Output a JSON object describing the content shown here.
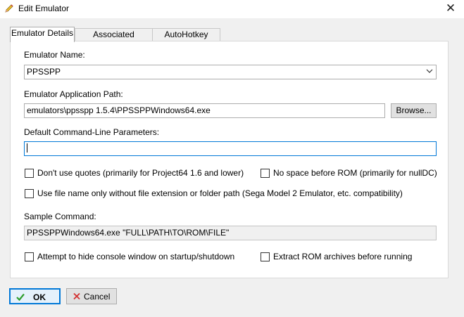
{
  "window": {
    "title": "Edit Emulator",
    "close_glyph": "✕"
  },
  "tabs": [
    {
      "label": "Emulator Details",
      "active": true
    },
    {
      "label": "Associated Platforms",
      "active": false
    },
    {
      "label": "AutoHotkey Script",
      "active": false
    }
  ],
  "form": {
    "name_label": "Emulator Name:",
    "name_value": "PPSSPP",
    "path_label": "Emulator Application Path:",
    "path_value": "emulators\\ppsspp 1.5.4\\PPSSPPWindows64.exe",
    "browse_label": "Browse...",
    "params_label": "Default Command-Line Parameters:",
    "params_value": "",
    "sample_label": "Sample Command:",
    "sample_value": "PPSSPPWindows64.exe \"FULL\\PATH\\TO\\ROM\\FILE\""
  },
  "checkboxes": {
    "no_quotes": {
      "label": "Don't use quotes (primarily for Project64 1.6 and lower)",
      "checked": false
    },
    "no_space": {
      "label": "No space before ROM (primarily for nullDC)",
      "checked": false
    },
    "filename_only": {
      "label": "Use file name only without file extension or folder path (Sega Model 2 Emulator, etc. compatibility)",
      "checked": false
    },
    "hide_console": {
      "label": "Attempt to hide console window on startup/shutdown",
      "checked": false
    },
    "extract_rom": {
      "label": "Extract ROM archives before running",
      "checked": false
    }
  },
  "buttons": {
    "ok_label": "OK",
    "cancel_label": "Cancel"
  },
  "icons": {
    "title": "pencil-icon",
    "dropdown": "chevron-down-icon",
    "ok": "checkmark-icon",
    "cancel": "x-icon"
  },
  "colors": {
    "accent": "#0078d7",
    "ok_icon": "#2e9e2e",
    "cancel_icon": "#d32f2f"
  }
}
